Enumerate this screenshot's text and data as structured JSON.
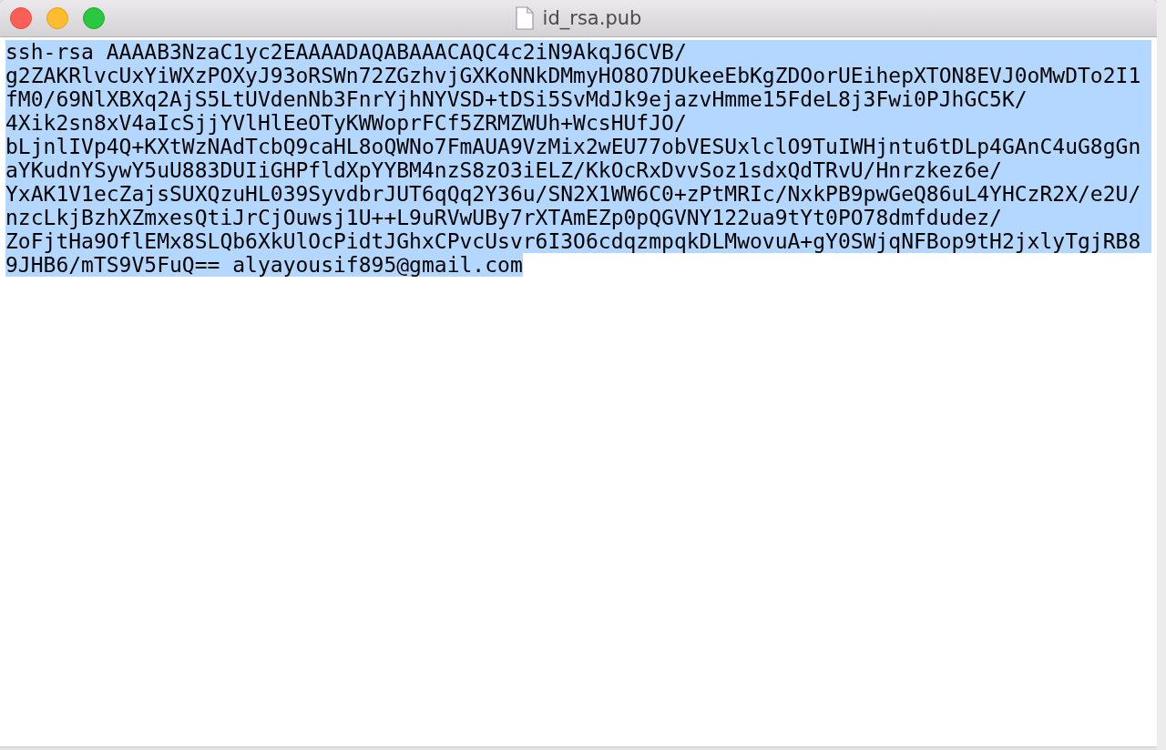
{
  "window": {
    "title": "id_rsa.pub"
  },
  "text": {
    "selected": true,
    "lines": [
      "ssh-rsa AAAAB3NzaC1yc2EAAAADAQABAAACAQC4c2iN9AkqJ6CVB/",
      "g2ZAKRlvcUxYiWXzPOXyJ93oRSWn72ZGzhvjGXKoNNkDMmyHO8O7DUkeeEbKgZDOorUEihepXTON8EVJ0oMwDTo2I1",
      "fM0/69NlXBXq2AjS5LtUVdenNb3FnrYjhNYVSD+tDSi5SvMdJk9ejazvHmme15FdeL8j3Fwi0PJhGC5K/",
      "4Xik2sn8xV4aIcSjjYVlHlEeOTyKWWoprFCf5ZRMZWUh+WcsHUfJO/",
      "bLjnlIVp4Q+KXtWzNAdTcbQ9caHL8oQWNo7FmAUA9VzMix2wEU77obVESUxlclO9TuIWHjntu6tDLp4GAnC4uG8gGn",
      "aYKudnYSywY5uU883DUIiGHPfldXpYYBM4nzS8zO3iELZ/KkOcRxDvvSoz1sdxQdTRvU/Hnrzkez6e/",
      "YxAK1V1ecZajsSUXQzuHL039SyvdbrJUT6qQq2Y36u/SN2X1WW6C0+zPtMRIc/NxkPB9pwGeQ86uL4YHCzR2X/e2U/",
      "nzcLkjBzhXZmxesQtiJrCjOuwsj1U++L9uRVwUBy7rXTAmEZp0pQGVNY122ua9tYt0PO78dmfdudez/",
      "ZoFjtHa9OflEMx8SLQb6XkUlOcPidtJGhxCPvcUsvr6I3O6cdqzmpqkDLMwovuA+gY0SWjqNFBop9tH2jxlyTgjRB8",
      "9JHB6/mTS9V5FuQ== alyayousif895@gmail.com"
    ]
  }
}
